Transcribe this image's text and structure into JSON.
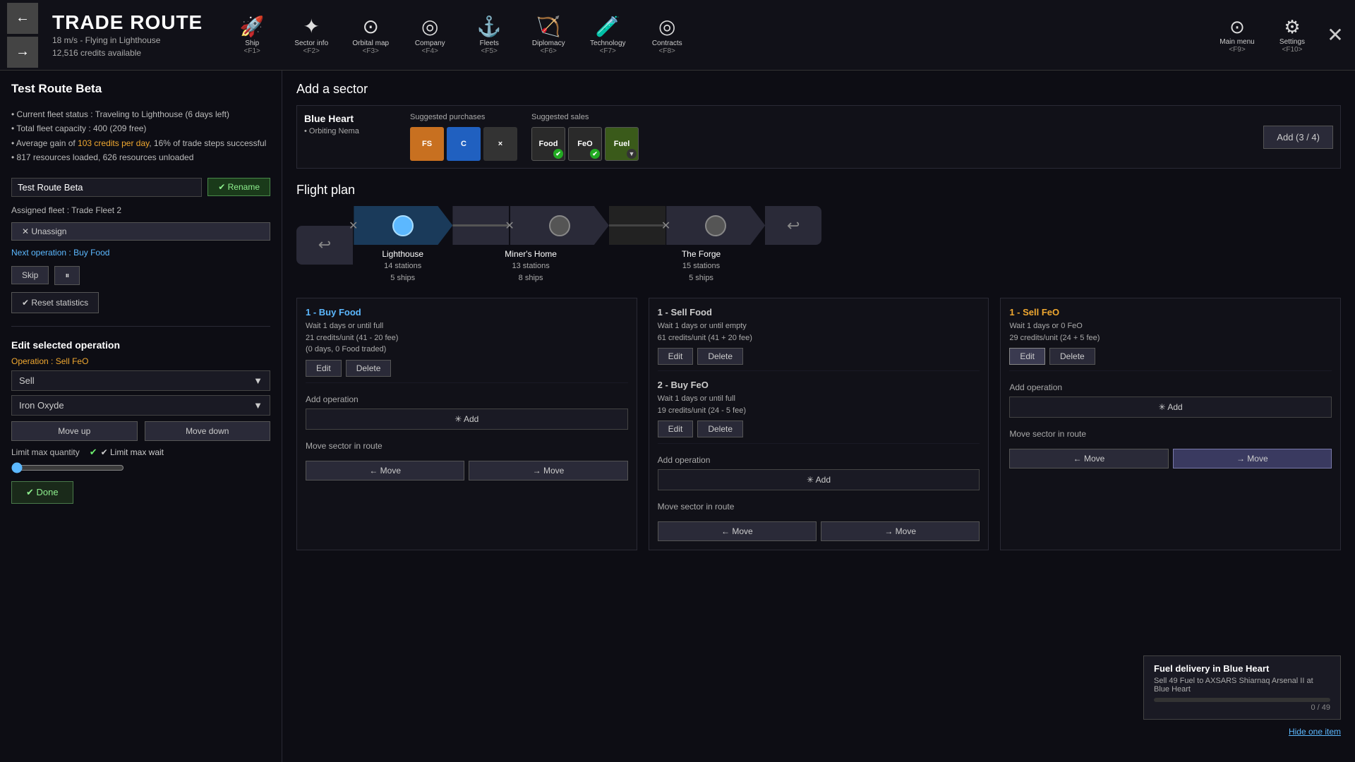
{
  "topbar": {
    "title": "TRADE ROUTE",
    "subtitle1": "18 m/s - Flying in Lighthouse",
    "subtitle2": "12,516 credits available",
    "back_arrow": "←",
    "forward_arrow": "→",
    "nav_items": [
      {
        "label": "Ship",
        "key": "<F1>",
        "icon": "🚀"
      },
      {
        "label": "Sector info",
        "key": "<F2>",
        "icon": "✦"
      },
      {
        "label": "Orbital map",
        "key": "<F3>",
        "icon": "⊙"
      },
      {
        "label": "Company",
        "key": "<F4>",
        "icon": "◎"
      },
      {
        "label": "Fleets",
        "key": "<F5>",
        "icon": "⚓"
      },
      {
        "label": "Diplomacy",
        "key": "<F6>",
        "icon": "🏹"
      },
      {
        "label": "Technology",
        "key": "<F7>",
        "icon": "🧪"
      },
      {
        "label": "Contracts",
        "key": "<F8>",
        "icon": "◎"
      }
    ],
    "main_menu_label": "Main menu",
    "main_menu_key": "<F9>",
    "settings_label": "Settings",
    "settings_key": "<F10>",
    "close_icon": "✕"
  },
  "left": {
    "route_name_display": "Test Route Beta",
    "status_lines": [
      "• Current fleet status : Traveling to Lighthouse (6 days left)",
      "• Total fleet capacity : 400 (209 free)",
      "• Average gain of 103 credits per day, 16% of trade steps successful",
      "• 817 resources loaded, 626 resources unloaded"
    ],
    "highlight_text": "103 credits per day",
    "route_name_input": "Test Route Beta",
    "rename_btn": "✔ Rename",
    "assigned_fleet_label": "Assigned fleet : Trade Fleet 2",
    "unassign_btn": "✕ Unassign",
    "next_op_label": "Next operation :",
    "next_op_value": "Buy Food",
    "skip_btn": "Skip",
    "pause_icon": "⏸",
    "reset_stats_btn": "✔ Reset statistics",
    "edit_section_title": "Edit selected operation",
    "operation_label": "Operation :",
    "operation_value": "Sell FeO",
    "dropdown_action": "Sell",
    "dropdown_resource": "Iron Oxyde",
    "move_up_btn": "Move up",
    "move_down_btn": "Move down",
    "limit_max_quantity_label": "Limit max quantity",
    "limit_max_wait_label": "✔ Limit max wait",
    "done_btn": "✔ Done"
  },
  "right": {
    "add_sector_title": "Add a sector",
    "sector": {
      "name": "Blue Heart",
      "info": "• Orbiting Nema"
    },
    "suggested_purchases_title": "Suggested purchases",
    "suggested_purchases": [
      {
        "label": "FS",
        "color": "orange"
      },
      {
        "label": "C",
        "color": "blue"
      },
      {
        "label": "×",
        "color": "dark"
      }
    ],
    "suggested_sales_title": "Suggested sales",
    "suggested_sales": [
      {
        "label": "Food",
        "checked": true
      },
      {
        "label": "FeO",
        "checked": true
      },
      {
        "label": "Fuel",
        "checked": false
      }
    ],
    "add_btn": "Add (3 / 4)",
    "flight_plan_title": "Flight plan",
    "flight_plan_nodes": [
      {
        "name": "Lighthouse",
        "stations": "14 stations",
        "ships": "5 ships",
        "active": true,
        "circle_color": "blue"
      },
      {
        "name": "Miner's Home",
        "stations": "13 stations",
        "ships": "8 ships",
        "active": false,
        "circle_color": "gray"
      },
      {
        "name": "The Forge",
        "stations": "15 stations",
        "ships": "5 ships",
        "active": false,
        "circle_color": "gray"
      }
    ],
    "columns": [
      {
        "operations": [
          {
            "id": "1",
            "title": "1 - Buy Food",
            "color": "blue",
            "desc": "Wait 1 days or until full\n21 credits/unit (41 - 20 fee)\n(0 days, 0 Food traded)",
            "edit_btn": "Edit",
            "delete_btn": "Delete"
          }
        ],
        "add_operation_label": "Add operation",
        "add_btn": "✳ Add",
        "move_sector_label": "Move sector in route",
        "move_left_btn": "← Move",
        "move_right_btn": "→ Move"
      },
      {
        "operations": [
          {
            "id": "1",
            "title": "1 - Sell Food",
            "color": "white",
            "desc": "Wait 1 days or until empty\n61 credits/unit (41 + 20 fee)",
            "edit_btn": "Edit",
            "delete_btn": "Delete"
          },
          {
            "id": "2",
            "title": "2 - Buy FeO",
            "color": "white",
            "desc": "Wait 1 days or until full\n19 credits/unit (24 - 5 fee)",
            "edit_btn": "Edit",
            "delete_btn": "Delete"
          }
        ],
        "add_operation_label": "Add operation",
        "add_btn": "✳ Add",
        "move_sector_label": "Move sector in route",
        "move_left_btn": "← Move",
        "move_right_btn": "→ Move"
      },
      {
        "operations": [
          {
            "id": "1",
            "title": "1 - Sell FeO",
            "color": "orange",
            "desc": "Wait 1 days or 0 FeO\n29 credits/unit (24 + 5 fee)",
            "edit_btn": "Edit",
            "delete_btn": "Delete",
            "edit_active": true
          }
        ],
        "add_operation_label": "Add operation",
        "add_btn": "✳ Add",
        "move_sector_label": "Move sector in route",
        "move_left_btn": "← Move",
        "move_right_btn": "→ Move",
        "move_right_active": true
      }
    ],
    "tooltip": {
      "title": "Fuel delivery in Blue Heart",
      "subtitle": "Sell 49 Fuel to AXSARS Shiarnaq Arsenal II at Blue Heart",
      "progress": "0 / 49",
      "progress_pct": 0,
      "hide_btn": "Hide one item"
    }
  }
}
